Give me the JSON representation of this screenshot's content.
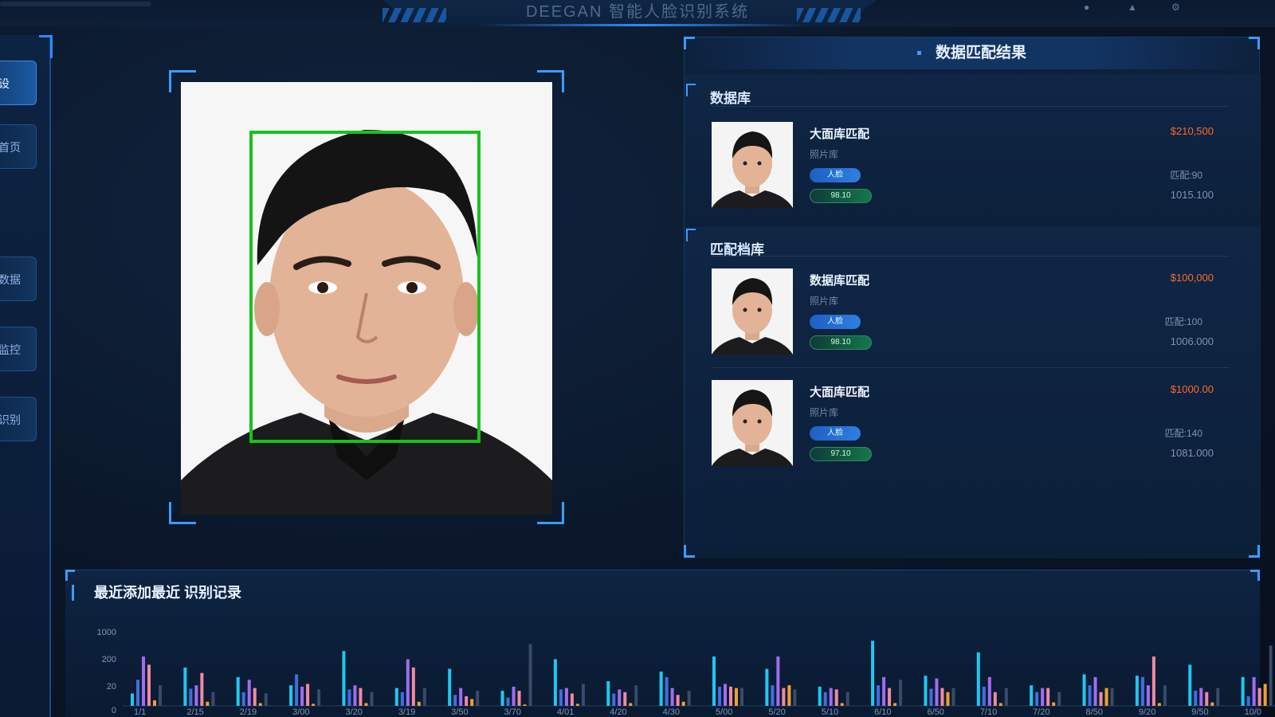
{
  "header": {
    "title": "DEEGAN 智能人脸识别系统",
    "right_icons": [
      "user-icon",
      "bell-icon",
      "settings-icon"
    ]
  },
  "sidebar": {
    "items": [
      {
        "label": "设",
        "active": true
      },
      {
        "label": "首页",
        "active": false
      },
      {
        "label": "数据",
        "active": false
      },
      {
        "label": "监控",
        "active": false
      },
      {
        "label": "识别",
        "active": false
      }
    ]
  },
  "main_photo": {
    "face_box_color": "#18c21a"
  },
  "results": {
    "title": "数据匹配结果",
    "sections": [
      {
        "title": "数据库",
        "cards": [
          {
            "name": "大面库匹配",
            "sub": "照片库",
            "tag": "人脸",
            "match": "98.10",
            "price": "$210,500",
            "meta1": "匹配:90",
            "meta2": "1015.100"
          }
        ]
      },
      {
        "title": "匹配档库",
        "cards": [
          {
            "name": "数据库匹配",
            "sub": "照片库",
            "tag": "人脸",
            "match": "98.10",
            "price": "$100,000",
            "meta1": "匹配:100",
            "meta2": "1006.000"
          },
          {
            "name": "大面库匹配",
            "sub": "照片库",
            "tag": "人脸",
            "match": "97.10",
            "price": "$1000.00",
            "meta1": "匹配:140",
            "meta2": "1081.000"
          }
        ]
      }
    ]
  },
  "history": {
    "title": "最近添加最近 识别记录"
  },
  "chart_data": {
    "type": "bar",
    "title": "最近添加最近 识别记录",
    "ylim": [
      0,
      1000
    ],
    "yticks": [
      "1000",
      "200",
      "20",
      "0"
    ],
    "categories": [
      "1/1",
      "2/15",
      "2/19",
      "3/00",
      "3/20",
      "3/19",
      "3/50",
      "3/70",
      "4/01",
      "4/20",
      "4/30",
      "5/00",
      "5/20",
      "5/10",
      "6/10",
      "6/50",
      "7/10",
      "7/20",
      "8/50",
      "9/20",
      "9/50",
      "10/0"
    ],
    "series": [
      {
        "name": "cyan",
        "color": "#1ec8f0",
        "values": [
          180,
          560,
          420,
          300,
          800,
          260,
          540,
          220,
          680,
          360,
          500,
          720,
          540,
          280,
          950,
          440,
          780,
          300,
          460,
          440,
          600,
          420
        ]
      },
      {
        "name": "blue",
        "color": "#3f6fe0",
        "values": [
          380,
          250,
          200,
          460,
          240,
          200,
          160,
          120,
          240,
          180,
          420,
          280,
          300,
          200,
          300,
          250,
          280,
          200,
          300,
          420,
          220,
          140
        ]
      },
      {
        "name": "violet",
        "color": "#a06cf0",
        "values": [
          720,
          300,
          380,
          280,
          300,
          680,
          260,
          280,
          260,
          240,
          260,
          320,
          720,
          260,
          420,
          400,
          420,
          260,
          420,
          300,
          260,
          420
        ]
      },
      {
        "name": "pink",
        "color": "#f08aa0",
        "values": [
          600,
          480,
          260,
          320,
          260,
          560,
          140,
          220,
          180,
          200,
          160,
          280,
          260,
          240,
          260,
          260,
          200,
          260,
          200,
          720,
          200,
          260
        ]
      },
      {
        "name": "orange",
        "color": "#f0a030",
        "values": [
          80,
          60,
          40,
          30,
          40,
          60,
          100,
          20,
          30,
          40,
          60,
          260,
          300,
          40,
          40,
          200,
          40,
          50,
          260,
          40,
          50,
          320
        ]
      },
      {
        "name": "dark",
        "color": "#3a4a6a",
        "values": [
          300,
          200,
          180,
          240,
          200,
          260,
          220,
          900,
          320,
          300,
          220,
          260,
          240,
          200,
          380,
          260,
          260,
          200,
          260,
          300,
          260,
          880
        ]
      }
    ]
  }
}
